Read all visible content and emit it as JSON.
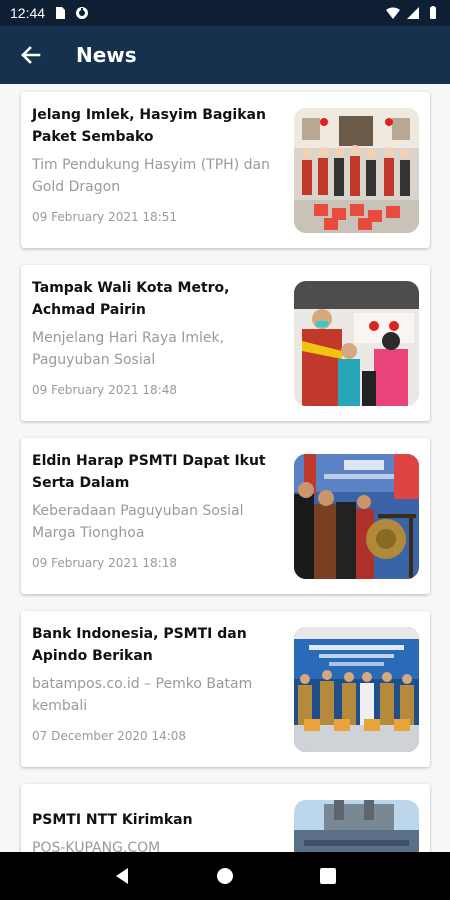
{
  "status_bar": {
    "time": "12:44",
    "icons": [
      "sd-card-icon",
      "sync-icon",
      "wifi-icon",
      "signal-icon",
      "battery-icon"
    ]
  },
  "app_bar": {
    "title": "News",
    "back_icon": "arrow-left-icon"
  },
  "news": [
    {
      "title": "Jelang Imlek, Hasyim Bagikan Paket Sembako",
      "description": "Tim Pendukung Hasyim (TPH) dan Gold Dragon",
      "date": "09 February 2021 18:51"
    },
    {
      "title": "Tampak Wali Kota Metro, Achmad Pairin",
      "description": "Menjelang Hari Raya Imlek, Paguyuban Sosial",
      "date": "09 February 2021 18:48"
    },
    {
      "title": "Eldin Harap PSMTI Dapat Ikut Serta Dalam",
      "description": "Keberadaan Paguyuban Sosial Marga Tionghoa",
      "date": "09 February 2021 18:18"
    },
    {
      "title": "Bank Indonesia, PSMTI dan Apindo Berikan",
      "description": "batampos.co.id – Pemko Batam kembali",
      "date": "07 December 2020 14:08"
    },
    {
      "title": "PSMTI NTT Kirimkan",
      "description": "POS-KUPANG.COM",
      "date": ""
    }
  ],
  "nav_bar": {
    "icons": [
      "back-triangle-icon",
      "home-circle-icon",
      "recents-square-icon"
    ]
  },
  "colors": {
    "status_bar": "#0e1f33",
    "app_bar": "#16314e",
    "card_title": "#111111",
    "card_secondary": "#9a9a9a"
  }
}
